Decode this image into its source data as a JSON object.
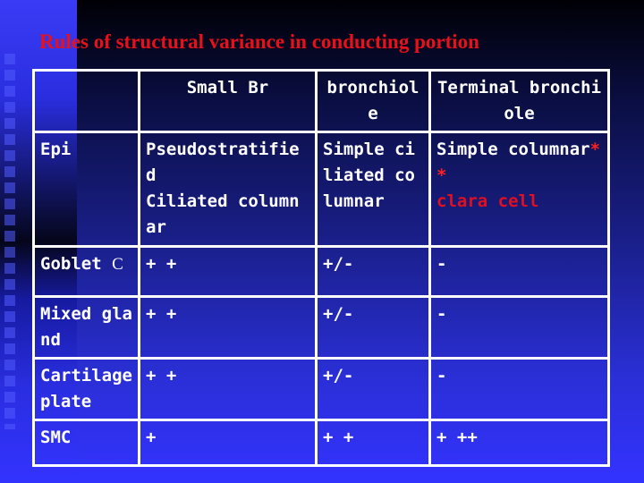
{
  "slide": {
    "title": "Rules of structural variance in conducting portion",
    "colors": {
      "title": "#e8101a",
      "header_text": "#ffff44",
      "body_text": "#ffffff",
      "highlight": "#e01020"
    }
  },
  "table": {
    "headers": [
      "",
      "Small Br",
      "bronchiole",
      "Terminal bronchiole"
    ],
    "rows": [
      {
        "label": "Epi",
        "small_br": [
          "Pseudostratified",
          "Ciliated columnar"
        ],
        "bronchiole": "Simple ciliated columnar",
        "terminal_main": "Simple columnar",
        "terminal_marker": "**",
        "terminal_highlight": "clara cell"
      },
      {
        "label": "Goblet",
        "label_suffix": "C",
        "small_br": "+ +",
        "bronchiole": "+/-",
        "terminal": "-"
      },
      {
        "label": "Mixed gland",
        "small_br": "+ +",
        "bronchiole": "+/-",
        "terminal": "-"
      },
      {
        "label": "Cartilage plate",
        "small_br": "+ +",
        "bronchiole": "+/-",
        "terminal": "-"
      },
      {
        "label": "SMC",
        "small_br": "+",
        "bronchiole": "+ +",
        "terminal": "+ ++"
      }
    ]
  }
}
